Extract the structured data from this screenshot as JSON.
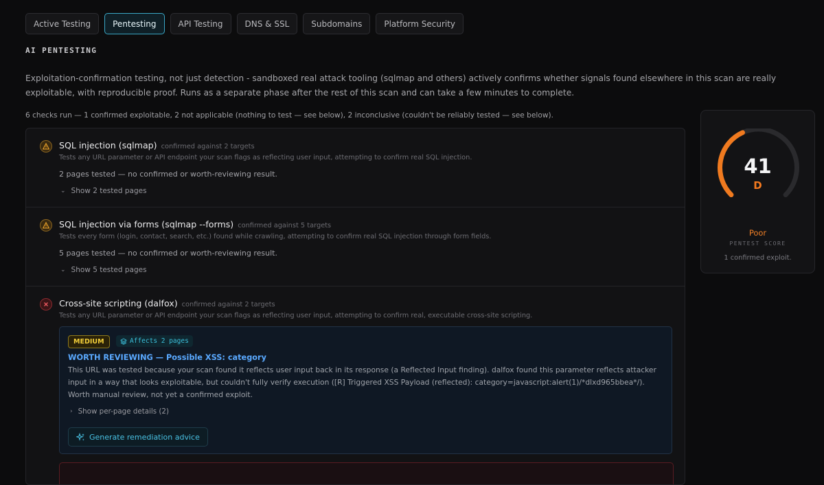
{
  "tabs": [
    {
      "label": "Active Testing",
      "active": false
    },
    {
      "label": "Pentesting",
      "active": true
    },
    {
      "label": "API Testing",
      "active": false
    },
    {
      "label": "DNS & SSL",
      "active": false
    },
    {
      "label": "Subdomains",
      "active": false
    },
    {
      "label": "Platform Security",
      "active": false
    }
  ],
  "section_title": "AI PENTESTING",
  "intro": "Exploitation-confirmation testing, not just detection - sandboxed real attack tooling (sqlmap and others) actively confirms whether signals found elsewhere in this scan are really exploitable, with reproducible proof. Runs as a separate phase after the rest of this scan and can take a few minutes to complete.",
  "summary": "6 checks run — 1 confirmed exploitable, 2 not applicable (nothing to test — see below), 2 inconclusive (couldn't be reliably tested — see below).",
  "checks": [
    {
      "status": "warning",
      "status_icon": "warning-triangle-icon",
      "name": "SQL injection (sqlmap)",
      "confirmed_against": "confirmed against 2 targets",
      "description": "Tests any URL parameter or API endpoint your scan flags as reflecting user input, attempting to confirm real SQL injection.",
      "result": "2 pages tested — no confirmed or worth-reviewing result.",
      "toggle": "Show 2 tested pages"
    },
    {
      "status": "warning",
      "status_icon": "warning-triangle-icon",
      "name": "SQL injection via forms (sqlmap --forms)",
      "confirmed_against": "confirmed against 5 targets",
      "description": "Tests every form (login, contact, search, etc.) found while crawling, attempting to confirm real SQL injection through form fields.",
      "result": "5 pages tested — no confirmed or worth-reviewing result.",
      "toggle": "Show 5 tested pages"
    },
    {
      "status": "failed",
      "status_icon": "x-circle-icon",
      "name": "Cross-site scripting (dalfox)",
      "confirmed_against": "confirmed against 2 targets",
      "description": "Tests any URL parameter or API endpoint your scan flags as reflecting user input, attempting to confirm real, executable cross-site scripting."
    }
  ],
  "finding": {
    "severity": "MEDIUM",
    "affects": "Affects 2 pages",
    "title": "WORTH REVIEWING — Possible XSS: category",
    "body": "This URL was tested because your scan found it reflects user input back in its response (a Reflected Input finding). dalfox found this parameter reflects attacker input in a way that looks exploitable, but couldn't fully verify execution ([R] Triggered XSS Payload (reflected): category=javascript:alert(1)/*dlxd965bbea*/). Worth manual review, not yet a confirmed exploit.",
    "per_page_toggle": "Show per-page details (2)",
    "remediation_button": "Generate remediation advice"
  },
  "score": {
    "value": "41",
    "value_fraction": 0.41,
    "grade": "D",
    "rating": "Poor",
    "label": "PENTEST SCORE",
    "note": "1 confirmed exploit.",
    "color": "#f07a1f",
    "track_color": "#2a2a2d"
  }
}
